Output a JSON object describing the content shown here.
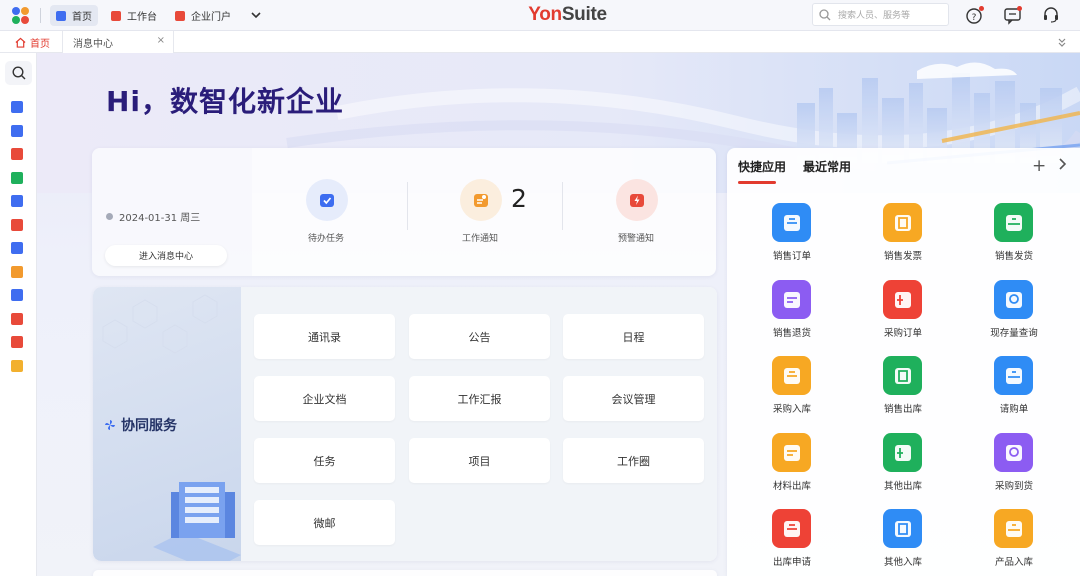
{
  "topbar": {
    "nav_tabs": [
      {
        "label": "首页",
        "icon": "home-tab-icon",
        "color": "#3f6df0"
      },
      {
        "label": "工作台",
        "icon": "workbench-icon",
        "color": "#e84a3a"
      },
      {
        "label": "企业门户",
        "icon": "portal-icon",
        "color": "#e84a3a"
      }
    ],
    "brand": {
      "part1": "Yon",
      "part2": "Suite"
    },
    "search_placeholder": "搜索人员、服务等",
    "brand_color": "#e23b2f"
  },
  "page_tabs": [
    {
      "label": "首页",
      "icon": "home-icon"
    },
    {
      "label": "消息中心",
      "close": "×"
    }
  ],
  "banner": {
    "greeting": "Hi，数智化新企业"
  },
  "message_card": {
    "date": "2024-01-31 周三",
    "enter_button": "进入消息中心",
    "items": [
      {
        "label": "待办任务",
        "icon": "todo-check-icon",
        "color": "#3d6df0",
        "bg": "#e6ecfb"
      },
      {
        "label": "工作通知",
        "icon": "work-notice-icon",
        "color": "#f29a2e",
        "bg": "#fbeede",
        "count": "2"
      },
      {
        "label": "预警通知",
        "icon": "alert-bolt-icon",
        "color": "#e84a3a",
        "bg": "#fbe4e1"
      }
    ]
  },
  "collab": {
    "title": "协同服务",
    "buttons": [
      "通讯录",
      "公告",
      "日程",
      "企业文档",
      "工作汇报",
      "会议管理",
      "任务",
      "项目",
      "工作圈",
      "微邮"
    ]
  },
  "quick_panel": {
    "tabs": [
      "快捷应用",
      "最近常用"
    ],
    "plus": "+",
    "apps": [
      {
        "label": "销售订单",
        "color": "#2f8cf5"
      },
      {
        "label": "销售发票",
        "color": "#f7a823"
      },
      {
        "label": "销售发货",
        "color": "#1fb05c"
      },
      {
        "label": "销售退货",
        "color": "#8c5cf2"
      },
      {
        "label": "采购订单",
        "color": "#ee4236"
      },
      {
        "label": "现存量查询",
        "color": "#2f8cf5"
      },
      {
        "label": "采购入库",
        "color": "#f7a823"
      },
      {
        "label": "销售出库",
        "color": "#1fb05c"
      },
      {
        "label": "请购单",
        "color": "#2f8cf5"
      },
      {
        "label": "材料出库",
        "color": "#f7a823"
      },
      {
        "label": "其他出库",
        "color": "#1fb05c"
      },
      {
        "label": "采购到货",
        "color": "#8c5cf2"
      },
      {
        "label": "出库申请",
        "color": "#ee4236"
      },
      {
        "label": "其他入库",
        "color": "#2f8cf5"
      },
      {
        "label": "产品入库",
        "color": "#f7a823"
      }
    ]
  },
  "sidebar_icons": [
    {
      "name": "folder-icon",
      "color": "#3f6df0"
    },
    {
      "name": "doc-edit-icon",
      "color": "#3f6df0"
    },
    {
      "name": "apps-grid-icon",
      "color": "#e84a3a"
    },
    {
      "name": "ledger-icon",
      "color": "#1fb05c"
    },
    {
      "name": "house-icon",
      "color": "#3f6df0"
    },
    {
      "name": "search-target-icon",
      "color": "#e84a3a"
    },
    {
      "name": "calendar-check-icon",
      "color": "#3f6df0"
    },
    {
      "name": "person-icon",
      "color": "#f29a2e"
    },
    {
      "name": "id-card-icon",
      "color": "#3f6df0"
    },
    {
      "name": "location-icon",
      "color": "#e84a3a"
    },
    {
      "name": "org-icon",
      "color": "#e84a3a"
    },
    {
      "name": "star-badge-icon",
      "color": "#f2b02e"
    }
  ]
}
